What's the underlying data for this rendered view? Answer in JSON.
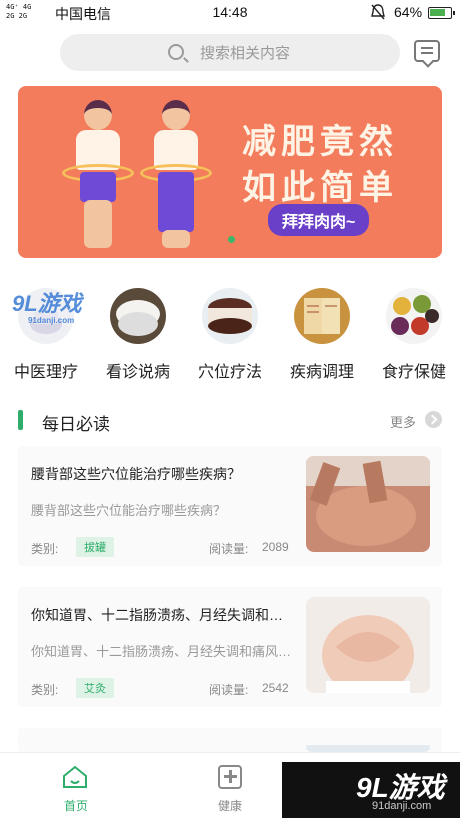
{
  "status_bar": {
    "network": "4G⁺ 4G\n2G 2G",
    "carrier": "中国电信",
    "time": "14:48",
    "battery": "64%"
  },
  "search": {
    "placeholder": "搜索相关内容"
  },
  "banner": {
    "title_line1": "减肥竟然",
    "title_line2": "如此简单",
    "tag": "拜拜肉肉~"
  },
  "categories": [
    {
      "label": "中医理疗",
      "icon": "teapot-icon"
    },
    {
      "label": "看诊说病",
      "icon": "bowl-icon"
    },
    {
      "label": "穴位疗法",
      "icon": "cake-icon"
    },
    {
      "label": "疾病调理",
      "icon": "book-icon"
    },
    {
      "label": "食疗保健",
      "icon": "grains-icon"
    }
  ],
  "watermark_top": {
    "logo": "9L游戏",
    "url": "91danji.com"
  },
  "section": {
    "title": "每日必读",
    "more": "更多"
  },
  "articles": [
    {
      "title": "腰背部这些穴位能治疗哪些疾病？",
      "summary": "腰背部这些穴位能治疗哪些疾病？",
      "category_label": "类别:",
      "category": "拔罐",
      "reads_label": "阅读量:",
      "reads": "2089"
    },
    {
      "title": "你知道胃、十二指肠溃疡、月经失调和痛…",
      "summary": "你知道胃、十二指肠溃疡、月经失调和痛风…",
      "category_label": "类别:",
      "category": "艾灸",
      "reads_label": "阅读量:",
      "reads": "2542"
    }
  ],
  "bottom_nav": [
    {
      "label": "首页",
      "active": true
    },
    {
      "label": "健康",
      "active": false
    }
  ],
  "watermark_bottom": {
    "logo": "9L游戏",
    "url": "91danji.com"
  },
  "colors": {
    "accent": "#2fae6b",
    "banner": "#f27c5c",
    "tag": "#6b40c9"
  }
}
